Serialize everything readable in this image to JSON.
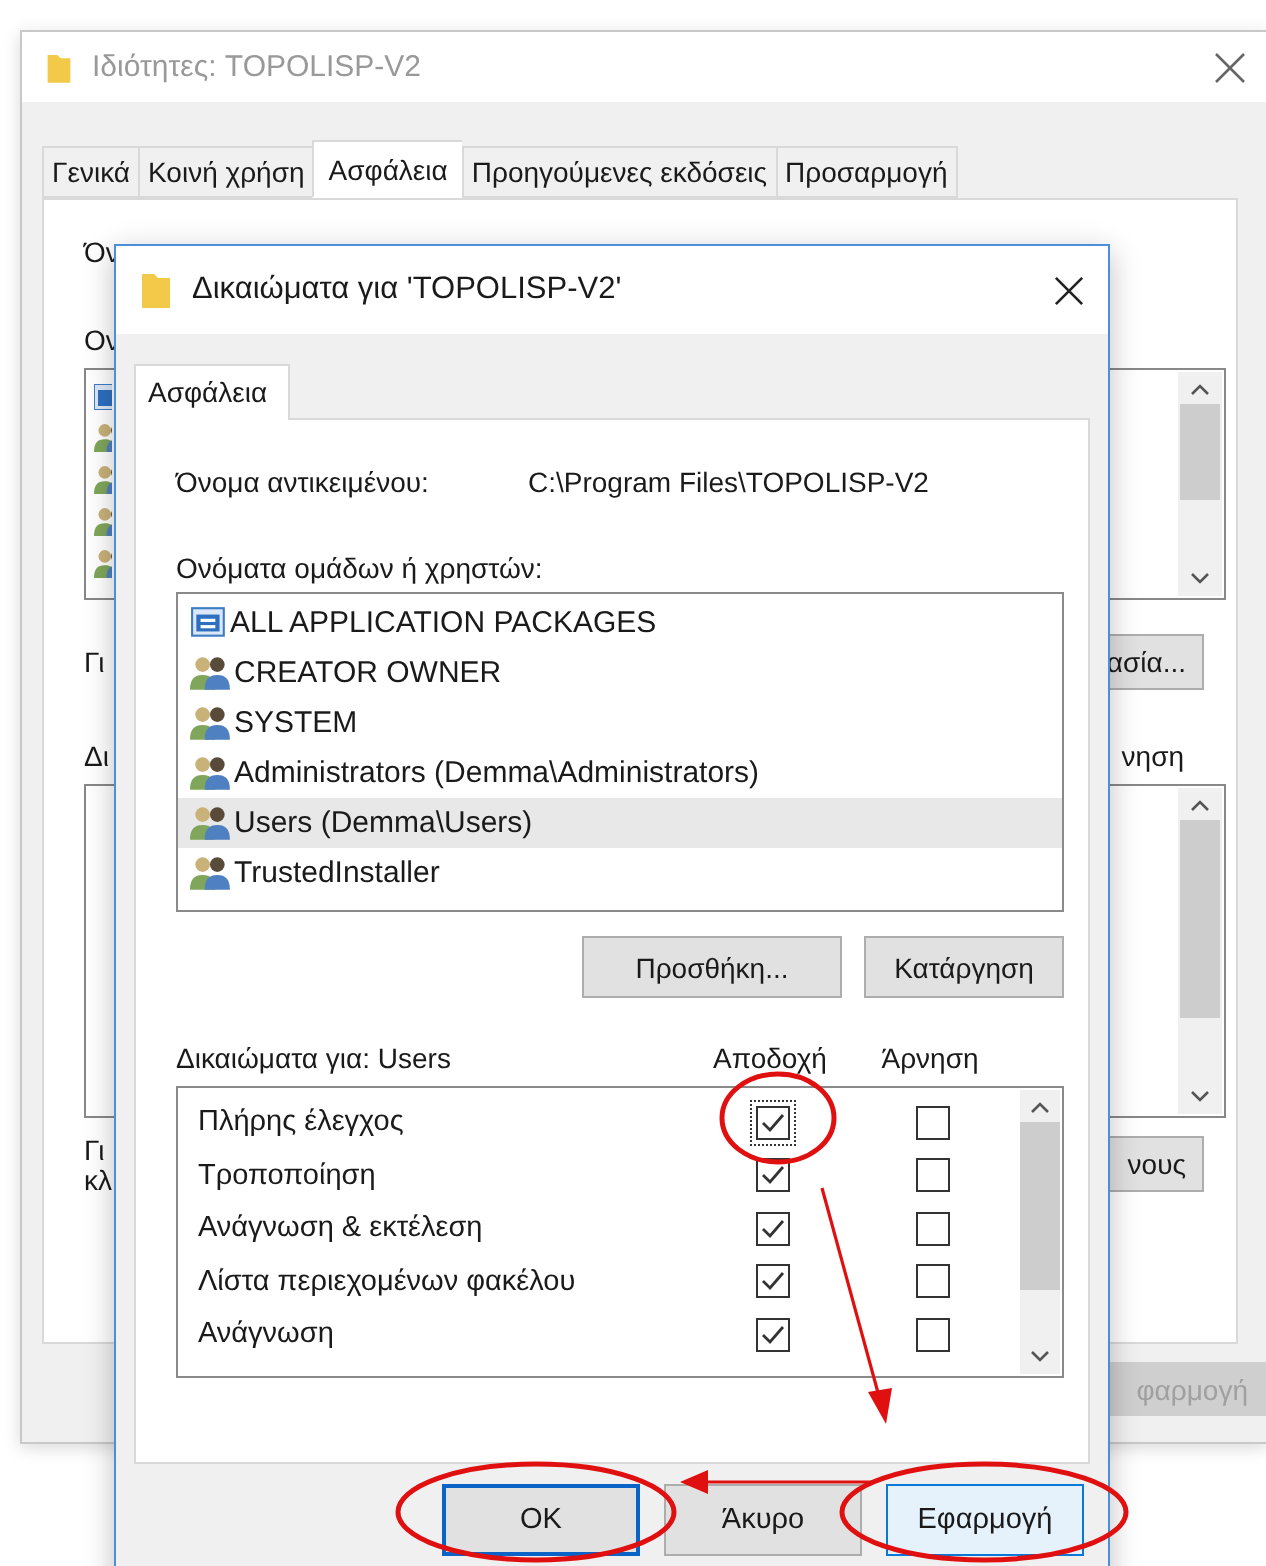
{
  "back_window": {
    "title": "Ιδιότητες: TOPOLISP-V2",
    "tabs": [
      {
        "label": "Γενικά",
        "selected": false
      },
      {
        "label": "Κοινή χρήση",
        "selected": false
      },
      {
        "label": "Ασφάλεια",
        "selected": true
      },
      {
        "label": "Προηγούμενες εκδόσεις",
        "selected": false
      },
      {
        "label": "Προσαρμογή",
        "selected": false
      }
    ],
    "object_label": "Όν",
    "groups_label": "Ον",
    "group_icons": [
      {
        "kind": "package"
      },
      {
        "kind": "group"
      },
      {
        "kind": "group"
      },
      {
        "kind": "group"
      },
      {
        "kind": "group"
      }
    ],
    "edit_hint": "Γι",
    "edit_button": "ασία...",
    "permissions_label": "Δι",
    "deny_header": "νηση",
    "advanced_hint": [
      "Γι",
      "κλ"
    ],
    "advanced_button": "νους",
    "apply_button": {
      "label": "φαρμογή",
      "disabled": true
    }
  },
  "dialog": {
    "title": "Δικαιώματα για 'TOPOLISP-V2'",
    "tab": {
      "label": "Ασφάλεια",
      "selected": true
    },
    "object_label": "Όνομα αντικειμένου:",
    "object_value": "C:\\Program Files\\TOPOLISP-V2",
    "groups_label": "Ονόματα ομάδων ή χρηστών:",
    "users": [
      {
        "name": "ALL APPLICATION PACKAGES",
        "kind": "package",
        "selected": false
      },
      {
        "name": "CREATOR OWNER",
        "kind": "group",
        "selected": false
      },
      {
        "name": "SYSTEM",
        "kind": "group",
        "selected": false
      },
      {
        "name": "Administrators (Demma\\Administrators)",
        "kind": "group",
        "selected": false
      },
      {
        "name": "Users (Demma\\Users)",
        "kind": "group",
        "selected": true
      },
      {
        "name": "TrustedInstaller",
        "kind": "group",
        "selected": false
      }
    ],
    "add_button": "Προσθήκη...",
    "remove_button": "Κατάργηση",
    "permissions_label": "Δικαιώματα για: Users",
    "allow_header": "Αποδοχή",
    "deny_header": "Άρνηση",
    "permissions": [
      {
        "name": "Πλήρης έλεγχος",
        "allow": true,
        "deny": false,
        "focused": true
      },
      {
        "name": "Τροποποίηση",
        "allow": true,
        "deny": false,
        "focused": false
      },
      {
        "name": "Ανάγνωση & εκτέλεση",
        "allow": true,
        "deny": false,
        "focused": false
      },
      {
        "name": "Λίστα περιεχομένων φακέλου",
        "allow": true,
        "deny": false,
        "focused": false
      },
      {
        "name": "Ανάγνωση",
        "allow": true,
        "deny": false,
        "focused": false
      }
    ],
    "buttons": [
      {
        "label": "OK",
        "kind": "default"
      },
      {
        "label": "Άκυρο",
        "kind": "normal"
      },
      {
        "label": "Εφαρμογή",
        "kind": "hover"
      }
    ]
  }
}
